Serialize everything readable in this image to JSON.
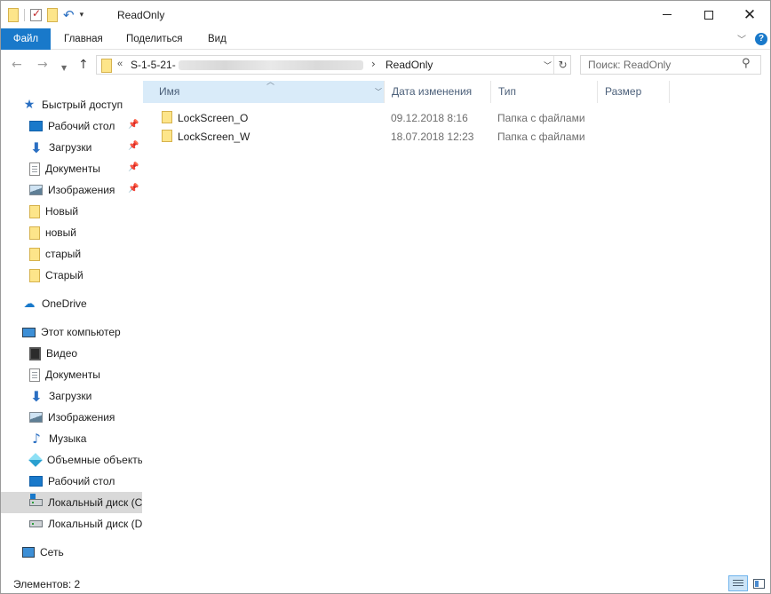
{
  "window": {
    "title": "ReadOnly"
  },
  "ribbon": {
    "tabs": [
      "Файл",
      "Главная",
      "Поделиться",
      "Вид"
    ]
  },
  "address": {
    "overflow": "«",
    "segment_root": "S-1-5-21-",
    "separator": "›",
    "segment_current": "ReadOnly"
  },
  "search": {
    "placeholder": "Поиск: ReadOnly"
  },
  "sidebar": {
    "quick_access": {
      "label": "Быстрый доступ",
      "items": [
        {
          "label": "Рабочий стол",
          "icon": "desktop-icon",
          "pinned": true
        },
        {
          "label": "Загрузки",
          "icon": "download-icon",
          "pinned": true
        },
        {
          "label": "Документы",
          "icon": "documents-icon",
          "pinned": true
        },
        {
          "label": "Изображения",
          "icon": "pictures-icon",
          "pinned": true
        },
        {
          "label": "Новый",
          "icon": "folder-icon",
          "pinned": false
        },
        {
          "label": "новый",
          "icon": "folder-icon",
          "pinned": false
        },
        {
          "label": "старый",
          "icon": "folder-icon",
          "pinned": false
        },
        {
          "label": "Старый",
          "icon": "folder-icon",
          "pinned": false
        }
      ]
    },
    "onedrive": {
      "label": "OneDrive"
    },
    "this_pc": {
      "label": "Этот компьютер",
      "items": [
        {
          "label": "Видео",
          "icon": "video-icon"
        },
        {
          "label": "Документы",
          "icon": "documents-icon"
        },
        {
          "label": "Загрузки",
          "icon": "download-icon"
        },
        {
          "label": "Изображения",
          "icon": "pictures-icon"
        },
        {
          "label": "Музыка",
          "icon": "music-icon"
        },
        {
          "label": "Объемные объекты",
          "icon": "3d-objects-icon"
        },
        {
          "label": "Рабочий стол",
          "icon": "desktop-icon"
        },
        {
          "label": "Локальный диск (C:)",
          "icon": "drive-c-icon",
          "selected": true
        },
        {
          "label": "Локальный диск (D:)",
          "icon": "drive-d-icon"
        }
      ]
    },
    "network": {
      "label": "Сеть"
    }
  },
  "columns": {
    "name": "Имя",
    "date": "Дата изменения",
    "type": "Тип",
    "size": "Размер"
  },
  "files": [
    {
      "name": "LockScreen_O",
      "date": "09.12.2018 8:16",
      "type": "Папка с файлами",
      "size": ""
    },
    {
      "name": "LockScreen_W",
      "date": "18.07.2018 12:23",
      "type": "Папка с файлами",
      "size": ""
    }
  ],
  "status": {
    "items_count": "Элементов: 2"
  },
  "colors": {
    "accent": "#1979ca",
    "selected_row": "#d9d9d9",
    "sorted_column": "#d9ebf9"
  }
}
